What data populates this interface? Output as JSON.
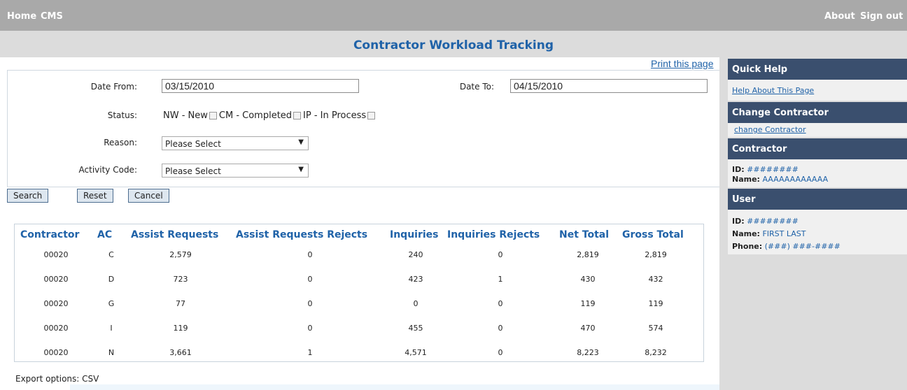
{
  "nav": {
    "home": "Home",
    "cms": "CMS",
    "about": "About",
    "signout": "Sign out"
  },
  "page": {
    "title": "Contractor Workload Tracking",
    "print": "Print this page"
  },
  "form": {
    "date_from_label": "Date From:",
    "date_from_value": "03/15/2010",
    "date_to_label": "Date To:",
    "date_to_value": "04/15/2010",
    "status_label": "Status:",
    "status_options": [
      "NW - New",
      "CM - Completed",
      "IP - In Process"
    ],
    "reason_label": "Reason:",
    "reason_value": "Please Select",
    "activity_label": "Activity Code:",
    "activity_value": "Please Select"
  },
  "buttons": {
    "search": "Search",
    "reset": "Reset",
    "cancel": "Cancel"
  },
  "table": {
    "headers": [
      "Contractor",
      "AC",
      "Assist Requests",
      "Assist Requests Rejects",
      "Inquiries",
      "Inquiries Rejects",
      "Net Total",
      "Gross Total"
    ],
    "rows": [
      [
        "00020",
        "C",
        "2,579",
        "0",
        "240",
        "0",
        "2,819",
        "2,819"
      ],
      [
        "00020",
        "D",
        "723",
        "0",
        "423",
        "1",
        "430",
        "432"
      ],
      [
        "00020",
        "G",
        "77",
        "0",
        "0",
        "0",
        "119",
        "119"
      ],
      [
        "00020",
        "I",
        "119",
        "0",
        "455",
        "0",
        "470",
        "574"
      ],
      [
        "00020",
        "N",
        "3,661",
        "1",
        "4,571",
        "0",
        "8,223",
        "8,232"
      ]
    ]
  },
  "export": "Export options: CSV",
  "sidebar": {
    "quick_help": {
      "title": "Quick Help",
      "link": "Help About This Page"
    },
    "change_contractor": {
      "title": "Change Contractor",
      "link": "change Contractor"
    },
    "contractor": {
      "title": "Contractor",
      "id_label": "ID:",
      "id_value": "########",
      "name_label": "Name:",
      "name_value": "AAAAAAAAAAAA"
    },
    "user": {
      "title": "User",
      "id_label": "ID:",
      "id_value": "########",
      "name_label": "Name:",
      "name_value": "FIRST LAST",
      "phone_label": "Phone:",
      "phone_value": "(###) ###-####"
    }
  }
}
